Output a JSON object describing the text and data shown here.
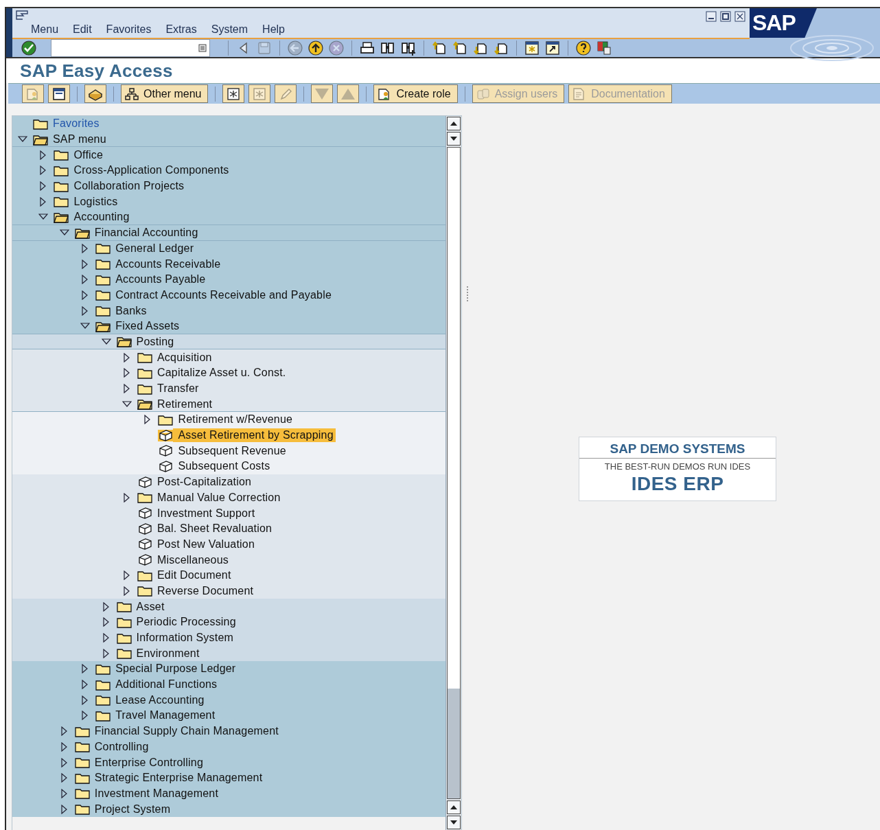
{
  "menu_bar": [
    "Menu",
    "Edit",
    "Favorites",
    "Extras",
    "System",
    "Help"
  ],
  "sap_logo": "SAP",
  "standard_toolbar": [
    [
      {
        "kind": "enter",
        "disabled": false
      }
    ],
    [
      {
        "kind": "back-triangle",
        "disabled": false
      },
      {
        "kind": "save",
        "disabled": true
      }
    ],
    [
      {
        "kind": "back",
        "disabled": true
      },
      {
        "kind": "exit",
        "disabled": false
      },
      {
        "kind": "cancel",
        "disabled": true
      }
    ],
    [
      {
        "kind": "print",
        "disabled": false
      },
      {
        "kind": "find",
        "disabled": false
      },
      {
        "kind": "find-next",
        "disabled": false
      }
    ],
    [
      {
        "kind": "first-page",
        "disabled": false
      },
      {
        "kind": "previous-page",
        "disabled": false
      },
      {
        "kind": "next-page",
        "disabled": false
      },
      {
        "kind": "last-page",
        "disabled": false
      }
    ],
    [
      {
        "kind": "new-session",
        "disabled": false
      },
      {
        "kind": "shortcut",
        "disabled": false
      }
    ],
    [
      {
        "kind": "help",
        "disabled": false
      },
      {
        "kind": "layout",
        "disabled": false
      }
    ]
  ],
  "title": "SAP Easy Access",
  "app_toolbar": [
    [
      {
        "kind": "user-menu",
        "disabled": true
      },
      {
        "kind": "sap-menu",
        "disabled": false
      }
    ],
    [
      {
        "kind": "basket",
        "disabled": false
      }
    ],
    [
      {
        "kind": "other-menu",
        "label": "Other menu",
        "disabled": false
      }
    ],
    [
      {
        "kind": "add-favorite",
        "disabled": false
      },
      {
        "kind": "change-favorite",
        "disabled": true
      },
      {
        "kind": "edit",
        "disabled": true
      }
    ],
    [
      {
        "kind": "move-down",
        "disabled": true
      },
      {
        "kind": "move-up",
        "disabled": true
      }
    ],
    [
      {
        "kind": "create-role",
        "label": "Create role",
        "disabled": false
      }
    ],
    [
      {
        "kind": "assign-users",
        "label": "Assign users",
        "disabled": true
      },
      {
        "kind": "documentation",
        "label": "Documentation",
        "disabled": true
      }
    ]
  ],
  "tree": [
    {
      "label": "Favorites",
      "kind": "favorites",
      "selected": false
    },
    {
      "label": "SAP menu",
      "kind": "folder",
      "expanded": true,
      "selected": false,
      "children": [
        {
          "label": "Office",
          "kind": "folder",
          "expanded": false,
          "selected": false
        },
        {
          "label": "Cross-Application Components",
          "kind": "folder",
          "expanded": false,
          "selected": false
        },
        {
          "label": "Collaboration Projects",
          "kind": "folder",
          "expanded": false,
          "selected": false
        },
        {
          "label": "Logistics",
          "kind": "folder",
          "expanded": false,
          "selected": false
        },
        {
          "label": "Accounting",
          "kind": "folder",
          "expanded": true,
          "selected": false,
          "children": [
            {
              "label": "Financial Accounting",
              "kind": "folder",
              "expanded": true,
              "selected": false,
              "children": [
                {
                  "label": "General Ledger",
                  "kind": "folder",
                  "expanded": false,
                  "selected": false
                },
                {
                  "label": "Accounts Receivable",
                  "kind": "folder",
                  "expanded": false,
                  "selected": false
                },
                {
                  "label": "Accounts Payable",
                  "kind": "folder",
                  "expanded": false,
                  "selected": false
                },
                {
                  "label": "Contract Accounts Receivable and Payable",
                  "kind": "folder",
                  "expanded": false,
                  "selected": false
                },
                {
                  "label": "Banks",
                  "kind": "folder",
                  "expanded": false,
                  "selected": false
                },
                {
                  "label": "Fixed Assets",
                  "kind": "folder",
                  "expanded": true,
                  "selected": false,
                  "children": [
                    {
                      "label": "Posting",
                      "kind": "folder",
                      "expanded": true,
                      "selected": false,
                      "children": [
                        {
                          "label": "Acquisition",
                          "kind": "folder",
                          "expanded": false,
                          "selected": false
                        },
                        {
                          "label": "Capitalize Asset u. Const.",
                          "kind": "folder",
                          "expanded": false,
                          "selected": false
                        },
                        {
                          "label": "Transfer",
                          "kind": "folder",
                          "expanded": false,
                          "selected": false
                        },
                        {
                          "label": "Retirement",
                          "kind": "folder",
                          "expanded": true,
                          "selected": false,
                          "children": [
                            {
                              "label": "Retirement w/Revenue",
                              "kind": "folder",
                              "expanded": false,
                              "selected": false
                            },
                            {
                              "label": "Asset Retirement by Scrapping",
                              "kind": "transaction",
                              "selected": true
                            },
                            {
                              "label": "Subsequent Revenue",
                              "kind": "transaction",
                              "selected": false
                            },
                            {
                              "label": "Subsequent Costs",
                              "kind": "transaction",
                              "selected": false
                            }
                          ]
                        },
                        {
                          "label": "Post-Capitalization",
                          "kind": "transaction",
                          "selected": false
                        },
                        {
                          "label": "Manual Value Correction",
                          "kind": "folder",
                          "expanded": false,
                          "selected": false
                        },
                        {
                          "label": "Investment Support",
                          "kind": "transaction",
                          "selected": false
                        },
                        {
                          "label": "Bal. Sheet Revaluation",
                          "kind": "transaction",
                          "selected": false
                        },
                        {
                          "label": "Post New Valuation",
                          "kind": "transaction",
                          "selected": false
                        },
                        {
                          "label": "Miscellaneous",
                          "kind": "transaction",
                          "selected": false
                        },
                        {
                          "label": "Edit Document",
                          "kind": "folder",
                          "expanded": false,
                          "selected": false
                        },
                        {
                          "label": "Reverse Document",
                          "kind": "folder",
                          "expanded": false,
                          "selected": false
                        }
                      ]
                    },
                    {
                      "label": "Asset",
                      "kind": "folder",
                      "expanded": false,
                      "selected": false
                    },
                    {
                      "label": "Periodic Processing",
                      "kind": "folder",
                      "expanded": false,
                      "selected": false
                    },
                    {
                      "label": "Information System",
                      "kind": "folder",
                      "expanded": false,
                      "selected": false
                    },
                    {
                      "label": "Environment",
                      "kind": "folder",
                      "expanded": false,
                      "selected": false
                    }
                  ]
                },
                {
                  "label": "Special Purpose Ledger",
                  "kind": "folder",
                  "expanded": false,
                  "selected": false
                },
                {
                  "label": "Additional Functions",
                  "kind": "folder",
                  "expanded": false,
                  "selected": false
                },
                {
                  "label": "Lease Accounting",
                  "kind": "folder",
                  "expanded": false,
                  "selected": false
                },
                {
                  "label": "Travel Management",
                  "kind": "folder",
                  "expanded": false,
                  "selected": false
                }
              ]
            },
            {
              "label": "Financial Supply Chain Management",
              "kind": "folder",
              "expanded": false,
              "selected": false
            },
            {
              "label": "Controlling",
              "kind": "folder",
              "expanded": false,
              "selected": false
            },
            {
              "label": "Enterprise Controlling",
              "kind": "folder",
              "expanded": false,
              "selected": false
            },
            {
              "label": "Strategic Enterprise Management",
              "kind": "folder",
              "expanded": false,
              "selected": false
            },
            {
              "label": "Investment Management",
              "kind": "folder",
              "expanded": false,
              "selected": false
            },
            {
              "label": "Project System",
              "kind": "folder",
              "expanded": false,
              "selected": false
            }
          ]
        }
      ]
    }
  ],
  "demo_banner": {
    "heading": "SAP DEMO SYSTEMS",
    "tagline": "THE BEST-RUN DEMOS RUN IDES",
    "product": "IDES ERP"
  }
}
